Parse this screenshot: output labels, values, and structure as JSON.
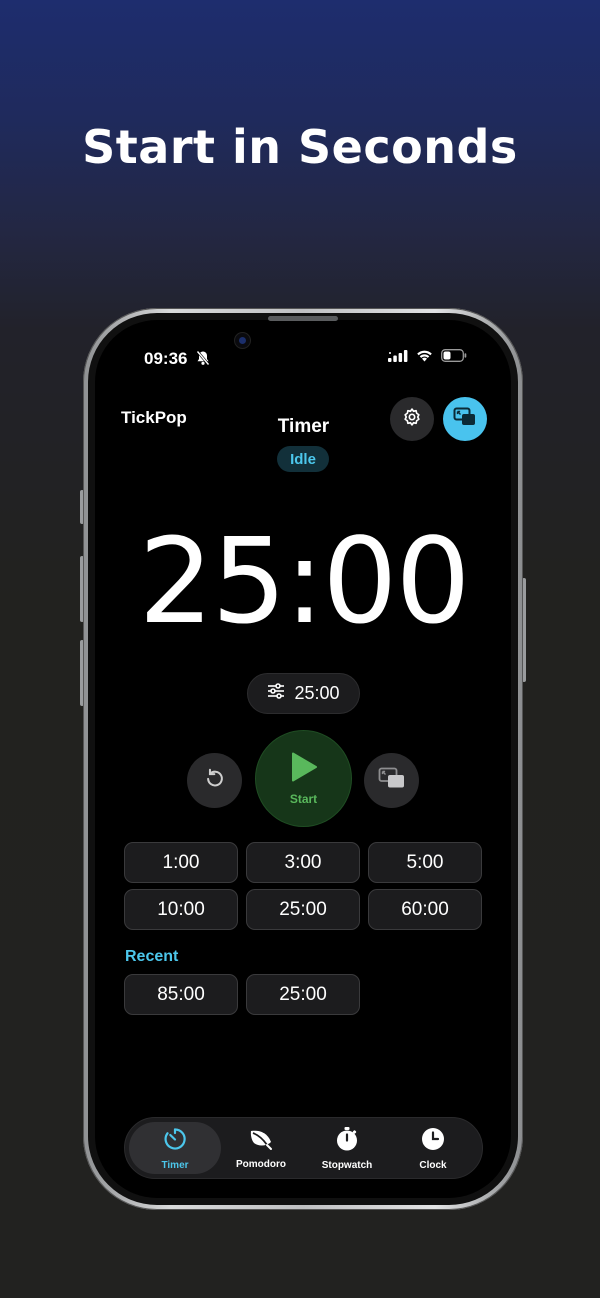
{
  "headline": "Start in Seconds",
  "status_bar": {
    "time": "09:36"
  },
  "header": {
    "app_name": "TickPop",
    "title": "Timer",
    "status": "Idle"
  },
  "timer": {
    "display": "25:00",
    "duration_chip": "25:00"
  },
  "controls": {
    "start_label": "Start"
  },
  "presets": [
    "1:00",
    "3:00",
    "5:00",
    "10:00",
    "25:00",
    "60:00"
  ],
  "recent": {
    "label": "Recent",
    "items": [
      "85:00",
      "25:00"
    ]
  },
  "tabs": [
    {
      "label": "Timer",
      "icon": "timer-icon",
      "active": true
    },
    {
      "label": "Pomodoro",
      "icon": "leaf-icon",
      "active": false
    },
    {
      "label": "Stopwatch",
      "icon": "stopwatch-icon",
      "active": false
    },
    {
      "label": "Clock",
      "icon": "clock-icon",
      "active": false
    }
  ],
  "colors": {
    "accent": "#4cc7ec",
    "start_green": "#59b85c",
    "background": "#000000"
  }
}
